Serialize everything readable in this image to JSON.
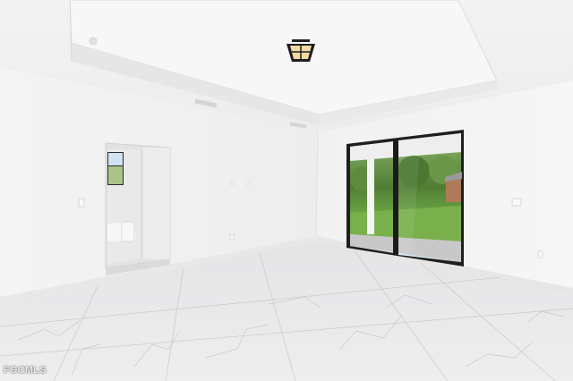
{
  "photo": {
    "subject": "empty-room-interior",
    "watermark": "FGCMLS"
  }
}
